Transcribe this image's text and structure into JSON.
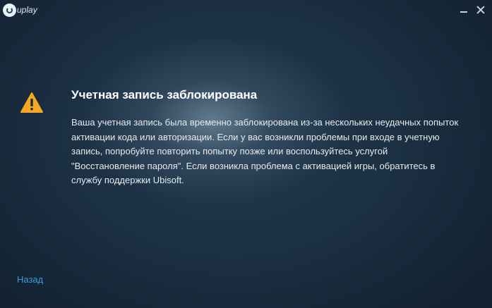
{
  "app": {
    "logo_text": "uplay"
  },
  "window_controls": {
    "minimize_icon": "minimize-icon",
    "close_icon": "close-icon"
  },
  "alert": {
    "icon": "warning-icon",
    "icon_color": "#f5a623",
    "title": "Учетная запись заблокирована",
    "message": "Ваша учетная запись была временно заблокирована из-за нескольких неудачных попыток активации кода или авторизации. Если у вас возникли проблемы при входе в учетную запись, попробуйте повторить попытку позже или воспользуйтесь услугой \"Восстановление пароля\". Если возникла проблема с активацией игры, обратитесь в службу поддержки Ubisoft."
  },
  "footer": {
    "back_label": "Назад",
    "link_color": "#3a9ad9"
  }
}
